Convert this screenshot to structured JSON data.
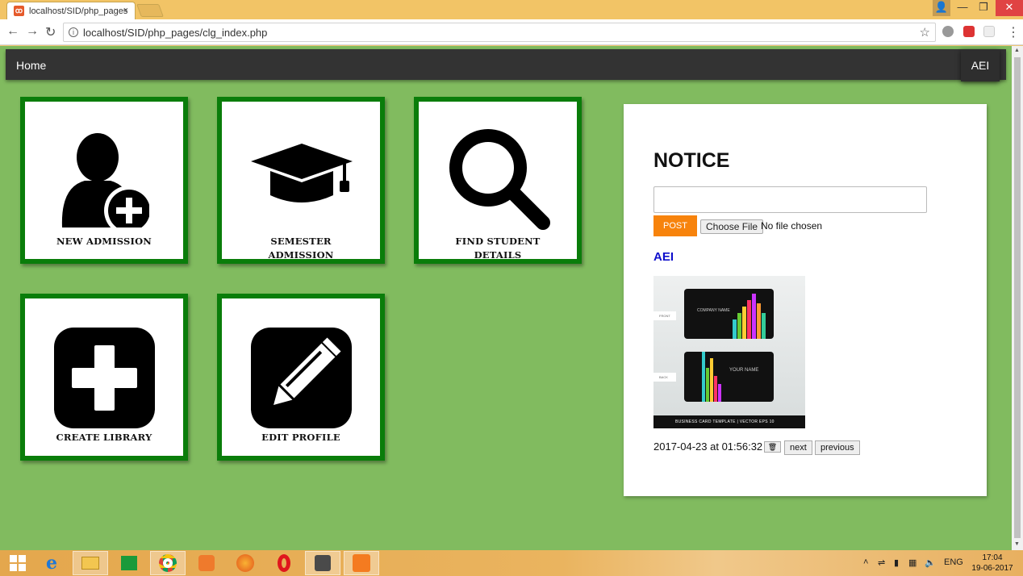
{
  "browser": {
    "tab_title": "localhost/SID/php_pages",
    "tab_close": "×",
    "url": "localhost/SID/php_pages/clg_index.php"
  },
  "navbar": {
    "home": "Home",
    "user": "AEI"
  },
  "tiles": [
    {
      "label_lines": [
        "NEW ADMISSION"
      ],
      "icon": "add-user-icon"
    },
    {
      "label_lines": [
        "SEMESTER",
        "ADMISSION"
      ],
      "icon": "graduation-cap-icon"
    },
    {
      "label_lines": [
        "FIND STUDENT",
        "DETAILS"
      ],
      "icon": "search-icon"
    },
    {
      "label_lines": [
        "CREATE LIBRARY"
      ],
      "icon": "plus-box-icon"
    },
    {
      "label_lines": [
        "EDIT PROFILE"
      ],
      "icon": "pencil-box-icon"
    }
  ],
  "notice": {
    "title": "NOTICE",
    "textarea_value": "",
    "post_button": "POST",
    "file_button": "Choose File",
    "file_status": "No file chosen",
    "poster_name": "AEI",
    "image_texts": {
      "front": "FRONT",
      "back": "BACK",
      "company": "COMPANY NAME",
      "your_name": "YOUR NAME",
      "footer": "BUSINESS CARD TEMPLATE   |   VECTOR EPS 10"
    },
    "timestamp": "2017-04-23 at 01:56:32",
    "delete_button": "🗑",
    "next_button": "next",
    "previous_button": "previous"
  },
  "taskbar": {
    "language": "ENG",
    "time": "17:04",
    "date": "19-06-2017"
  }
}
